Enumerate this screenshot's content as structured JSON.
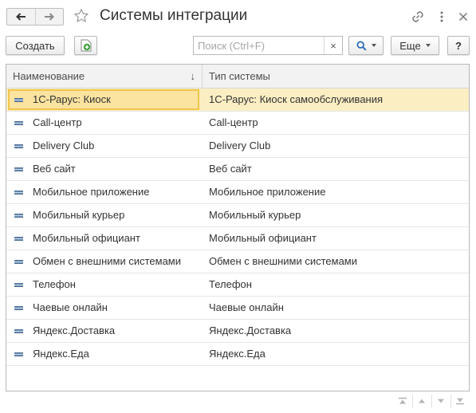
{
  "window": {
    "title": "Системы интеграции"
  },
  "toolbar": {
    "create_label": "Создать",
    "search_placeholder": "Поиск (Ctrl+F)",
    "clear_label": "×",
    "more_label": "Еще",
    "help_label": "?"
  },
  "table": {
    "columns": [
      "Наименование",
      "Тип системы"
    ],
    "sort_indicator": "↓",
    "rows": [
      {
        "name": "1С-Рарус: Киоск",
        "type": "1С-Рарус: Киоск самообслуживания",
        "selected": true
      },
      {
        "name": "Call-центр",
        "type": "Call-центр"
      },
      {
        "name": "Delivery Club",
        "type": "Delivery Club"
      },
      {
        "name": "Веб сайт",
        "type": "Веб сайт"
      },
      {
        "name": "Мобильное приложение",
        "type": "Мобильное приложение"
      },
      {
        "name": "Мобильный курьер",
        "type": "Мобильный курьер"
      },
      {
        "name": "Мобильный официант",
        "type": "Мобильный официант"
      },
      {
        "name": "Обмен с внешними системами",
        "type": "Обмен с внешними системами"
      },
      {
        "name": "Телефон",
        "type": "Телефон"
      },
      {
        "name": "Чаевые онлайн",
        "type": "Чаевые онлайн"
      },
      {
        "name": "Яндекс.Доставка",
        "type": "Яндекс.Доставка"
      },
      {
        "name": "Яндекс.Еда",
        "type": "Яндекс.Еда"
      }
    ]
  },
  "colors": {
    "selected_row": "#fbeec3",
    "selected_cell_border": "#f0c64b",
    "header_bg": "#f2f2f2",
    "add_icon_green": "#3aa03a"
  },
  "icons": [
    "back-arrow-icon",
    "forward-arrow-icon",
    "star-icon",
    "link-icon",
    "more-vertical-icon",
    "close-icon",
    "add-green-icon",
    "search-icon",
    "row-item-icon",
    "scroll-top-icon",
    "scroll-up-icon",
    "scroll-down-icon",
    "scroll-bottom-icon"
  ]
}
